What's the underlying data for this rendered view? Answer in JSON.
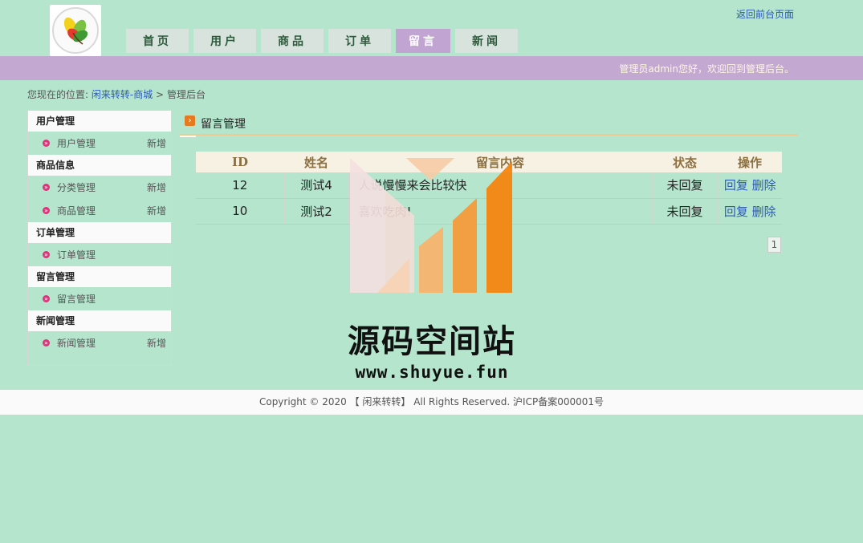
{
  "header": {
    "back_link": "返回前台页面",
    "welcome": "管理员admin您好，欢迎回到管理后台。"
  },
  "nav": [
    {
      "label": "首页"
    },
    {
      "label": "用户"
    },
    {
      "label": "商品"
    },
    {
      "label": "订单"
    },
    {
      "label": "留言"
    },
    {
      "label": "新闻"
    }
  ],
  "breadcrumb": {
    "prefix": "您现在的位置:",
    "site": "闲来转转-商城",
    "separator": ">",
    "current": "管理后台"
  },
  "sidebar": {
    "add_label": "新增",
    "sections": [
      {
        "title": "用户管理",
        "items": [
          {
            "label": "用户管理",
            "add": true
          }
        ]
      },
      {
        "title": "商品信息",
        "items": [
          {
            "label": "分类管理",
            "add": true
          },
          {
            "label": "商品管理",
            "add": true
          }
        ]
      },
      {
        "title": "订单管理",
        "items": [
          {
            "label": "订单管理",
            "add": false
          }
        ]
      },
      {
        "title": "留言管理",
        "items": [
          {
            "label": "留言管理",
            "add": false
          }
        ]
      },
      {
        "title": "新闻管理",
        "items": [
          {
            "label": "新闻管理",
            "add": true
          }
        ]
      }
    ]
  },
  "main": {
    "title": "留言管理",
    "columns": [
      "ID",
      "姓名",
      "留言内容",
      "状态",
      "操作"
    ],
    "rows": [
      {
        "id": "12",
        "name": "测试4",
        "content": "人说慢慢来会比较快",
        "status": "未回复"
      },
      {
        "id": "10",
        "name": "测试2",
        "content": "喜欢吃肉!",
        "status": "未回复"
      }
    ],
    "reply_label": "回复",
    "delete_label": "删除",
    "page": "1"
  },
  "watermark": {
    "title": "源码空间站",
    "url": "www.shuyue.fun"
  },
  "footer": {
    "text": "Copyright © 2020 【 闲来转转】 All Rights Reserved. 沪ICP备案000001号"
  },
  "colors": {
    "background": "#b5e6cd",
    "banner": "#c3a8d1",
    "nav_active": "#c2a4d2",
    "link": "#2b58b5"
  }
}
